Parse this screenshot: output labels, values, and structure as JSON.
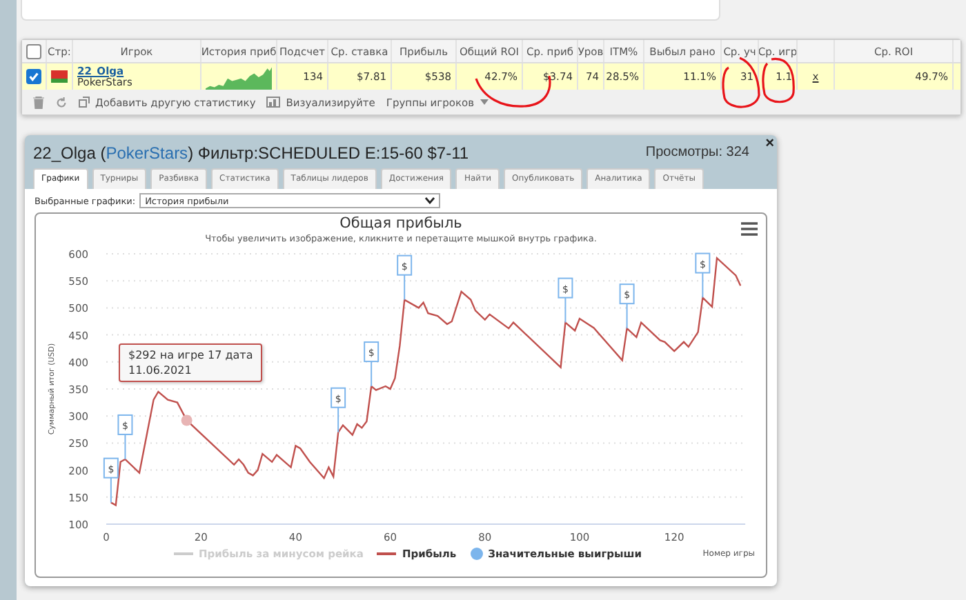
{
  "table": {
    "header_checkbox": {
      "checked": false
    },
    "columns": [
      "Стр:",
      "Игрок",
      "История приб",
      "Подсчет",
      "Ср. ставка",
      "Прибыль",
      "Общий ROI",
      "Ср. приб",
      "Уров",
      "ITM%",
      "Выбыл рано",
      "Ср. уч",
      "Ср. игр",
      "",
      "Ср. ROI"
    ],
    "rows": [
      {
        "checked": true,
        "cells": [
          {
            "kind": "flag"
          },
          {
            "kind": "player",
            "name": "22_Olga",
            "site": "PokerStars"
          },
          {
            "kind": "sparkline"
          },
          {
            "kind": "text",
            "text": "134"
          },
          {
            "kind": "text",
            "text": "$7.81"
          },
          {
            "kind": "text",
            "text": "$538"
          },
          {
            "kind": "text",
            "text": "42.7%"
          },
          {
            "kind": "text",
            "text": "$3.74"
          },
          {
            "kind": "text",
            "text": "74"
          },
          {
            "kind": "text",
            "text": "28.5%"
          },
          {
            "kind": "text",
            "text": "11.1%"
          },
          {
            "kind": "text",
            "text": "31"
          },
          {
            "kind": "text",
            "text": "1.1"
          },
          {
            "kind": "link",
            "text": "x"
          },
          {
            "kind": "text",
            "text": "49.7%"
          }
        ]
      }
    ],
    "toolbar": [
      {
        "kind": "trash"
      },
      {
        "kind": "refresh"
      },
      {
        "kind": "add",
        "label": "Добавить другую статистику"
      },
      {
        "kind": "chart",
        "label": "Визуализируйте"
      },
      {
        "kind": "menu",
        "label": "Группы игроков"
      }
    ]
  },
  "dialog": {
    "title_prefix": "22_Olga (",
    "title_site": "PokerStars",
    "title_suffix": ") Фильтр:SCHEDULED E:15-60 $7-11",
    "views": "Просмотры: 324",
    "close": "×",
    "tabs": [
      {
        "label": "Графики",
        "selected": true
      },
      {
        "label": "Турниры",
        "selected": false
      },
      {
        "label": "Разбивка",
        "selected": false
      },
      {
        "label": "Статистика",
        "selected": false
      },
      {
        "label": "Таблицы лидеров",
        "selected": false
      },
      {
        "label": "Достижения",
        "selected": false
      },
      {
        "label": "Найти",
        "selected": false
      },
      {
        "label": "Опубликовать",
        "selected": false
      },
      {
        "label": "Аналитика",
        "selected": false
      },
      {
        "label": "Отчёты",
        "selected": false
      }
    ],
    "select_label": "Выбранные графики:",
    "select_value": "История прибыли",
    "chart": {
      "subtitle": "Чтобы увеличить изображение, кликните и перетащите мышкой внутрь графика.",
      "tooltip": {
        "line1": "$292 на игре 17 дата",
        "line2": "11.06.2021"
      },
      "legend": [
        {
          "label": "Прибыль за минусом рейка",
          "visible": false,
          "color": "#cccccc"
        },
        {
          "label": "Значительные выигрыши",
          "visible": true,
          "color": "#7cb5ec"
        }
      ],
      "chart_data": {
        "type": "line",
        "title": "Общая прибыль",
        "xlabel": "Номер игры",
        "ylabel": "Суммарный итог (USD)",
        "xlim": [
          0,
          135
        ],
        "ylim": [
          100,
          600
        ],
        "xticks": [
          0,
          20,
          40,
          60,
          80,
          100,
          120
        ],
        "yticks": [
          100,
          150,
          200,
          250,
          300,
          350,
          400,
          450,
          500,
          550,
          600
        ],
        "grid": true,
        "x": [
          1,
          2,
          3,
          4,
          7,
          10,
          11,
          13,
          15,
          17,
          27,
          28,
          29,
          30,
          31,
          32,
          33,
          35,
          36,
          39,
          40,
          41,
          43,
          46,
          47,
          48,
          49,
          50,
          52,
          53,
          54,
          55,
          56,
          57,
          59,
          60,
          61,
          62,
          63,
          66,
          67,
          68,
          70,
          72,
          73,
          75,
          77,
          78,
          80,
          81,
          85,
          86,
          96,
          97,
          99,
          100,
          103,
          109,
          110,
          112,
          113,
          117,
          118,
          120,
          122,
          123,
          125,
          126,
          128,
          129,
          133,
          134
        ],
        "series": [
          {
            "name": "Прибыль",
            "color": "#c0504d",
            "values": [
              140,
              135,
              215,
              220,
              195,
              330,
              345,
              330,
              325,
              292,
              210,
              220,
              210,
              195,
              190,
              200,
              230,
              215,
              228,
              205,
              245,
              240,
              215,
              185,
              205,
              188,
              270,
              283,
              265,
              285,
              278,
              290,
              355,
              348,
              355,
              350,
              370,
              430,
              515,
              500,
              510,
              490,
              485,
              470,
              475,
              530,
              515,
              495,
              478,
              488,
              462,
              473,
              390,
              473,
              458,
              480,
              463,
              403,
              462,
              446,
              473,
              440,
              437,
              420,
              437,
              428,
              455,
              519,
              502,
              592,
              560,
              541
            ]
          }
        ],
        "annotations": [
          {
            "x": 1,
            "y": 140,
            "text": "$"
          },
          {
            "x": 4,
            "y": 220,
            "text": "$"
          },
          {
            "x": 49,
            "y": 270,
            "text": "$"
          },
          {
            "x": 56,
            "y": 355,
            "text": "$"
          },
          {
            "x": 63,
            "y": 515,
            "text": "$"
          },
          {
            "x": 97,
            "y": 473,
            "text": "$"
          },
          {
            "x": 110,
            "y": 462,
            "text": "$"
          },
          {
            "x": 126,
            "y": 519,
            "text": "$"
          }
        ]
      }
    }
  }
}
